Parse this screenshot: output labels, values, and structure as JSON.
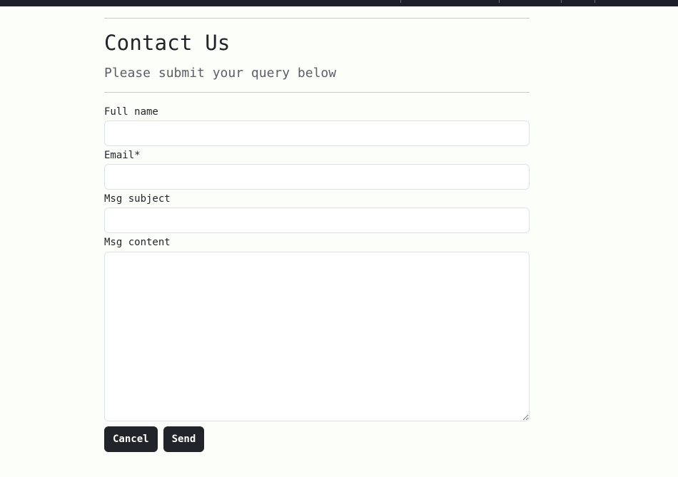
{
  "page": {
    "title": "Contact Us",
    "subtitle": "Please submit your query below"
  },
  "form": {
    "full_name": {
      "label": "Full name",
      "value": ""
    },
    "email": {
      "label": "Email*",
      "value": ""
    },
    "subject": {
      "label": "Msg subject",
      "value": ""
    },
    "content": {
      "label": "Msg content",
      "value": ""
    }
  },
  "actions": {
    "cancel_label": "Cancel",
    "send_label": "Send"
  },
  "colors": {
    "background": "#fcfef9",
    "topbar": "#1b1d28",
    "button": "#212529",
    "text": "#212529",
    "muted_text": "#5a5f64"
  }
}
